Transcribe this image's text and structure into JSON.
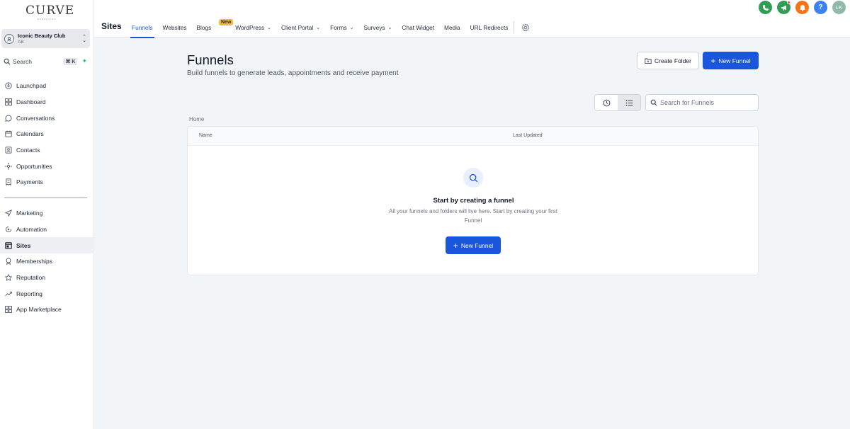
{
  "brand": {
    "logo_text": "CURVE",
    "logo_subtext": "MARKETING"
  },
  "account": {
    "name": "Iconic Beauty Club",
    "sub": "AB"
  },
  "search": {
    "label": "Search",
    "shortcut": "⌘ K"
  },
  "sidebar": {
    "items": [
      {
        "label": "Launchpad",
        "icon": "rocket-icon"
      },
      {
        "label": "Dashboard",
        "icon": "grid-icon"
      },
      {
        "label": "Conversations",
        "icon": "chat-icon"
      },
      {
        "label": "Calendars",
        "icon": "calendar-icon"
      },
      {
        "label": "Contacts",
        "icon": "contacts-icon"
      },
      {
        "label": "Opportunities",
        "icon": "opportunities-icon"
      },
      {
        "label": "Payments",
        "icon": "receipt-icon"
      }
    ],
    "items2": [
      {
        "label": "Marketing",
        "icon": "send-icon"
      },
      {
        "label": "Automation",
        "icon": "automation-icon"
      },
      {
        "label": "Sites",
        "icon": "sites-icon",
        "active": true
      },
      {
        "label": "Memberships",
        "icon": "badge-icon"
      },
      {
        "label": "Reputation",
        "icon": "star-icon"
      },
      {
        "label": "Reporting",
        "icon": "trend-icon"
      },
      {
        "label": "App Marketplace",
        "icon": "apps-icon"
      }
    ]
  },
  "topbar": {
    "title": "Sites",
    "tabs": {
      "funnels": "Funnels",
      "websites": "Websites",
      "blogs": "Blogs",
      "blogs_badge": "New",
      "wordpress": "WordPress",
      "client_portal": "Client Portal",
      "forms": "Forms",
      "surveys": "Surveys",
      "chat_widget": "Chat Widget",
      "media": "Media",
      "url_redirects": "URL Redirects"
    },
    "user_initials": "LK",
    "help": "?",
    "colors": {
      "phone": "#2f9e52",
      "megaphone": "#2f9e52",
      "bell": "#f97316",
      "help": "#3b82f6",
      "avatar": "#8fb9a8"
    }
  },
  "main": {
    "title": "Funnels",
    "subtitle": "Build funnels to generate leads, appointments and receive payment",
    "create_folder": "Create Folder",
    "new_funnel": "New Funnel",
    "search_placeholder": "Search for Funnels",
    "breadcrumb": "Home",
    "columns": {
      "name": "Name",
      "last_updated": "Last Updated"
    },
    "empty": {
      "title": "Start by creating a funnel",
      "text": "All your funnels and folders will live here. Start by creating your first Funnel",
      "button": "New Funnel"
    },
    "accent_color": "#1a56db"
  }
}
